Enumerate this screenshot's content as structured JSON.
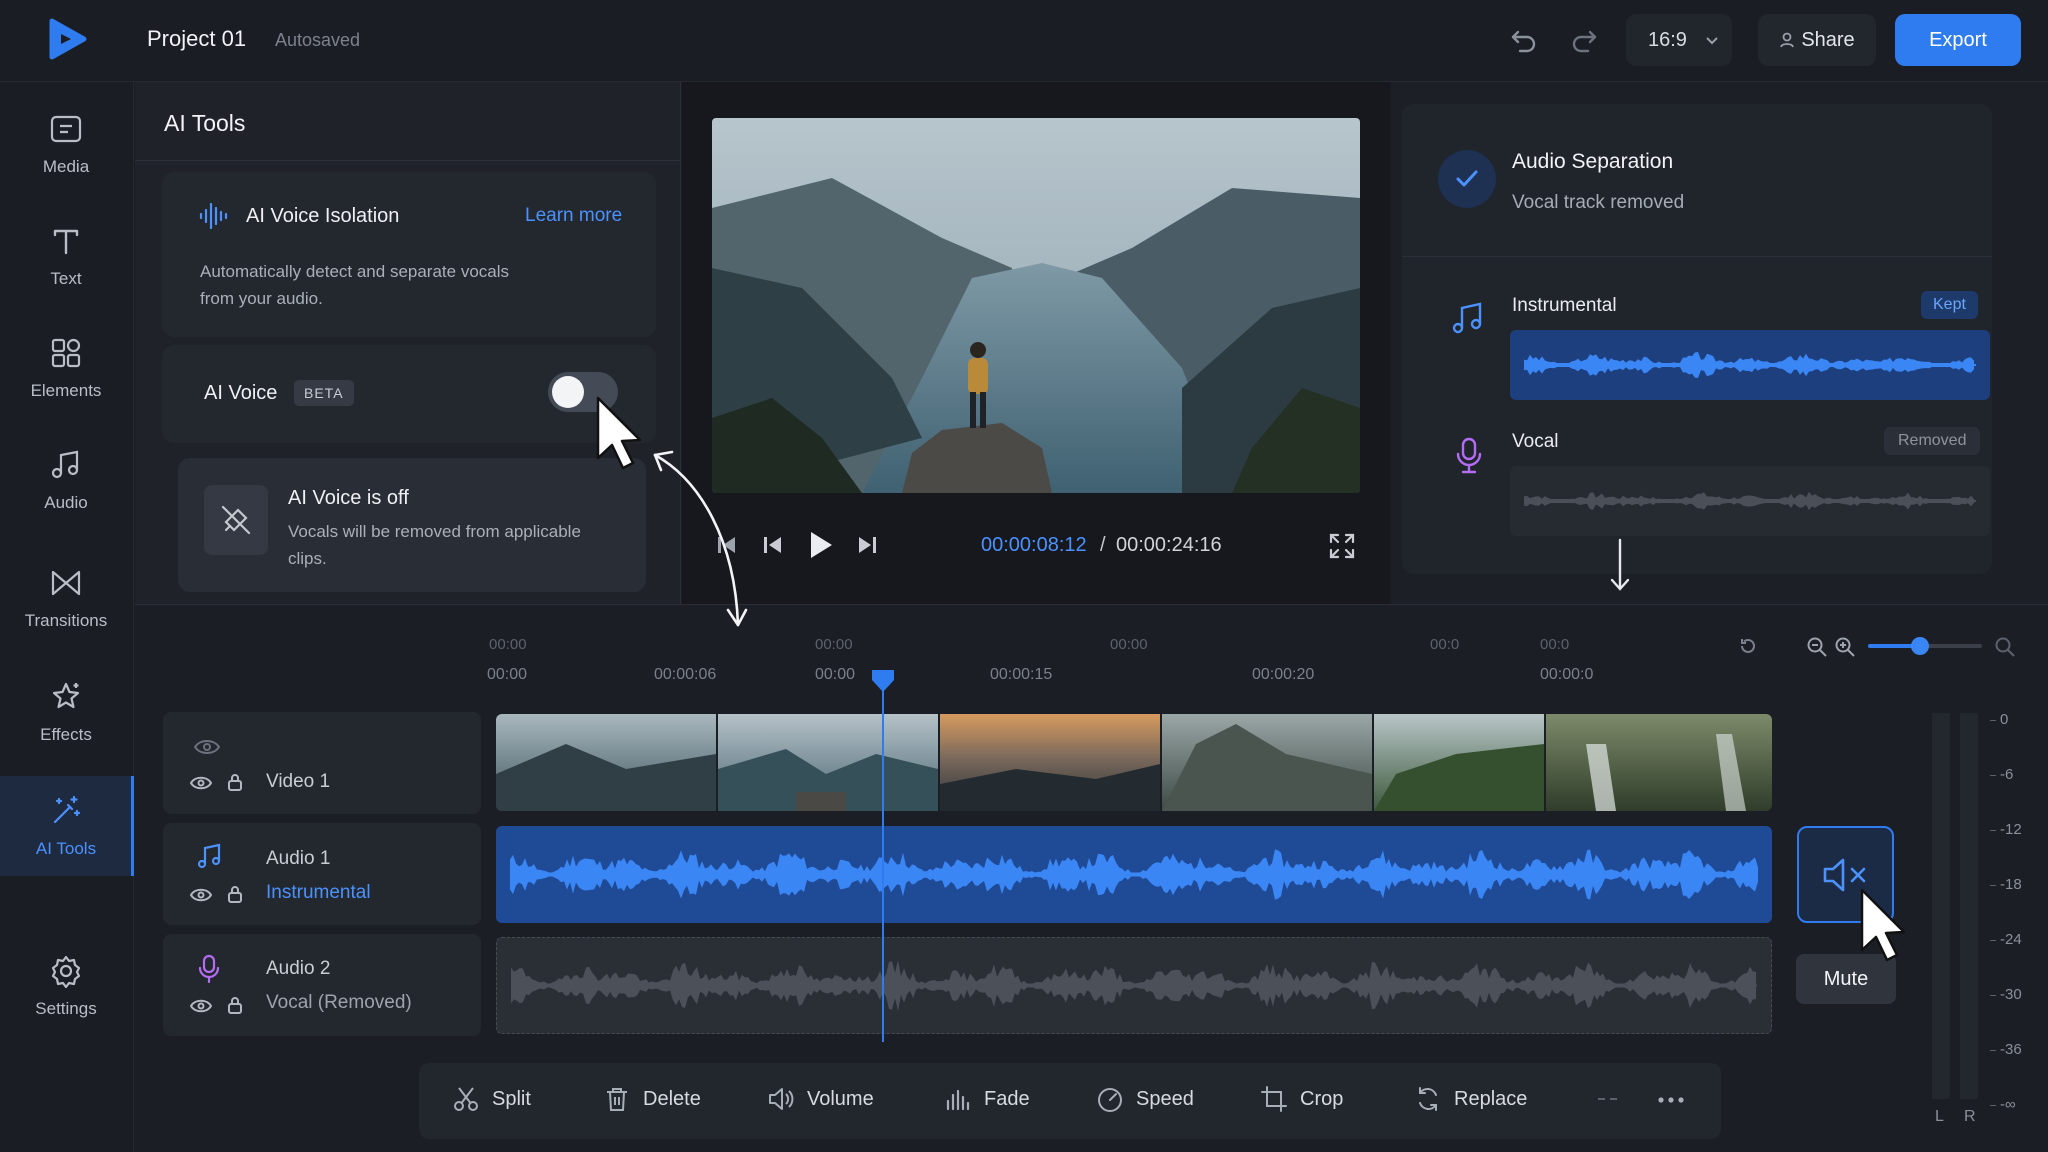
{
  "header": {
    "project_title": "Project 01",
    "autosave_status": "Autosaved",
    "aspect_ratio": "16:9",
    "share_label": "Share",
    "export_label": "Export",
    "accent_color": "#2f7bf0"
  },
  "rail": {
    "items": [
      {
        "label": "Media",
        "icon": "media-icon"
      },
      {
        "label": "Text",
        "icon": "text-icon"
      },
      {
        "label": "Elements",
        "icon": "elements-icon"
      },
      {
        "label": "Audio",
        "icon": "audio-icon"
      },
      {
        "label": "Transitions",
        "icon": "transitions-icon"
      },
      {
        "label": "Effects",
        "icon": "effects-icon"
      },
      {
        "label": "AI Tools",
        "icon": "ai-tools-icon",
        "active": true
      },
      {
        "label": "Settings",
        "icon": "settings-icon"
      }
    ]
  },
  "ai_panel": {
    "title": "AI Tools",
    "isolation": {
      "title": "AI Voice Isolation",
      "learn_more": "Learn more",
      "description": "Automatically detect and separate vocals from your audio."
    },
    "voice": {
      "label": "AI Voice",
      "badge": "BETA",
      "enabled": false
    },
    "off_notice": {
      "title": "AI Voice is off",
      "description": "Vocals will be removed from applicable clips."
    }
  },
  "preview": {
    "time_current": "00:00:08:12",
    "time_separator": "/",
    "time_total": "00:00:24:16"
  },
  "separation": {
    "title": "Audio Separation",
    "subtitle": "Vocal track removed",
    "instrumental": {
      "label": "Instrumental",
      "badge": "Kept"
    },
    "vocal": {
      "label": "Vocal",
      "badge": "Removed"
    }
  },
  "timeline": {
    "ruler_top": [
      "00:00",
      "00:00",
      "00:00",
      "00:0",
      "00:0"
    ],
    "ruler_bottom": [
      "00:00",
      "00:00:06",
      "00:00",
      "00:00:15",
      "00:00:20",
      "00:00:0"
    ],
    "zoom_level": 0.46,
    "tracks": [
      {
        "name": "Video 1",
        "sub": ""
      },
      {
        "name": "Audio 1",
        "sub": "Instrumental"
      },
      {
        "name": "Audio 2",
        "sub": "Vocal (Removed)"
      }
    ],
    "mute_tooltip": "Mute",
    "meter": {
      "db_labels": [
        "0",
        "-6",
        "-12",
        "-18",
        "-24",
        "-30",
        "-36",
        "-∞"
      ],
      "channels": [
        "L",
        "R"
      ]
    }
  },
  "toolbar": {
    "items": [
      {
        "label": "Split",
        "icon": "scissors-icon"
      },
      {
        "label": "Delete",
        "icon": "trash-icon"
      },
      {
        "label": "Volume",
        "icon": "speaker-icon"
      },
      {
        "label": "Fade",
        "icon": "fade-icon"
      },
      {
        "label": "Speed",
        "icon": "speedometer-icon"
      },
      {
        "label": "Crop",
        "icon": "crop-icon"
      },
      {
        "label": "Replace",
        "icon": "replace-icon"
      }
    ]
  }
}
